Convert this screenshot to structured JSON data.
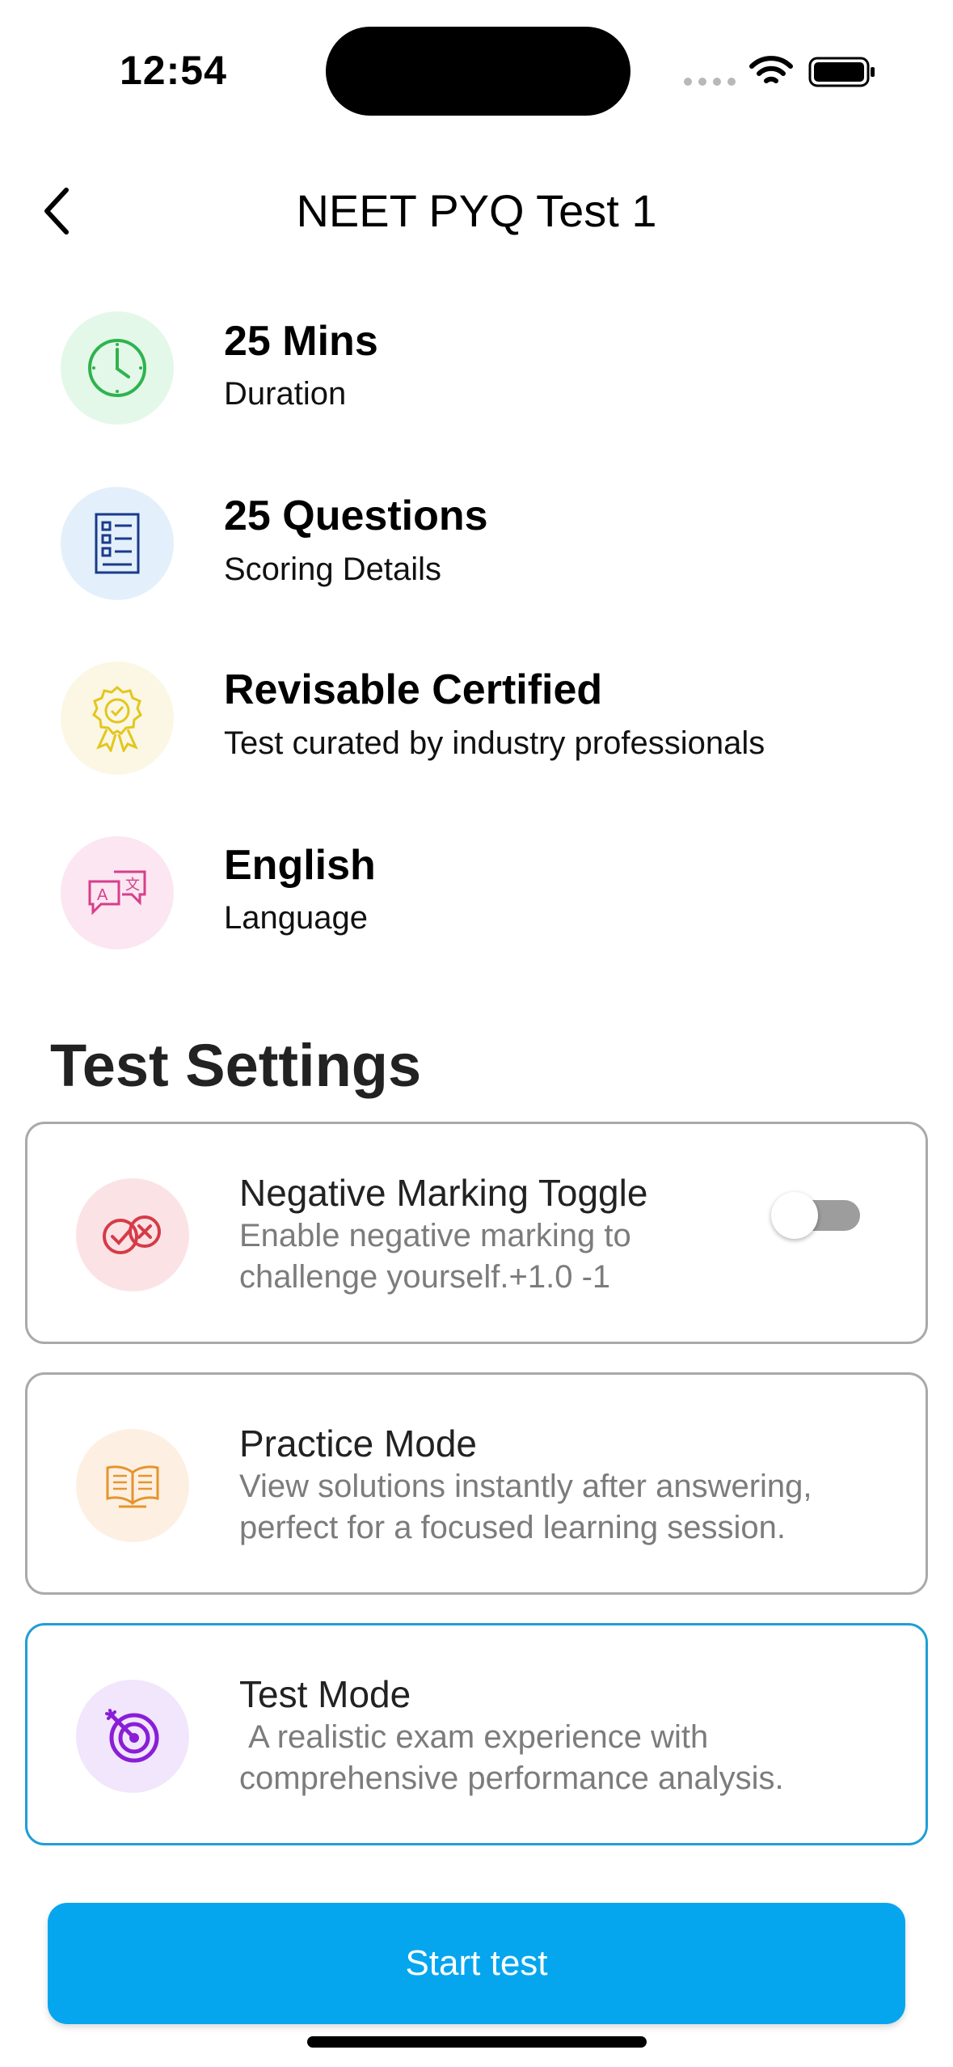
{
  "status_bar": {
    "time": "12:54"
  },
  "header": {
    "title": "NEET PYQ Test 1"
  },
  "info_items": [
    {
      "title": "25 Mins",
      "subtitle": "Duration",
      "icon": "clock-icon",
      "bg": "#e3f8e9",
      "color": "#2fb34e"
    },
    {
      "title": "25 Questions",
      "subtitle": "Scoring Details",
      "icon": "checklist-icon",
      "bg": "#e3f0fb",
      "color": "#1a3a8a"
    },
    {
      "title": "Revisable Certified",
      "subtitle": "Test curated by industry professionals",
      "icon": "award-badge-icon",
      "bg": "#fbf7e4",
      "color": "#e3c61d"
    },
    {
      "title": "English",
      "subtitle": "Language",
      "icon": "translate-icon",
      "bg": "#fbe6f1",
      "color": "#d63f8a"
    }
  ],
  "settings": {
    "title": "Test Settings",
    "negative_marking": {
      "title": "Negative Marking Toggle",
      "description": "Enable negative marking to\nchallenge yourself.+1.0 -1",
      "enabled": false,
      "icon": "check-cross-icon"
    },
    "practice_mode": {
      "title": "Practice Mode",
      "description": "View solutions instantly after answering,\nperfect for a focused learning session.",
      "icon": "open-book-icon"
    },
    "test_mode": {
      "title": "Test Mode",
      "description": " A realistic exam experience with\ncomprehensive performance analysis.",
      "selected": true,
      "icon": "target-icon"
    }
  },
  "start_button": {
    "label": "Start test"
  },
  "colors": {
    "accent": "#06a6ee",
    "selected_border": "#1e9fd6"
  }
}
